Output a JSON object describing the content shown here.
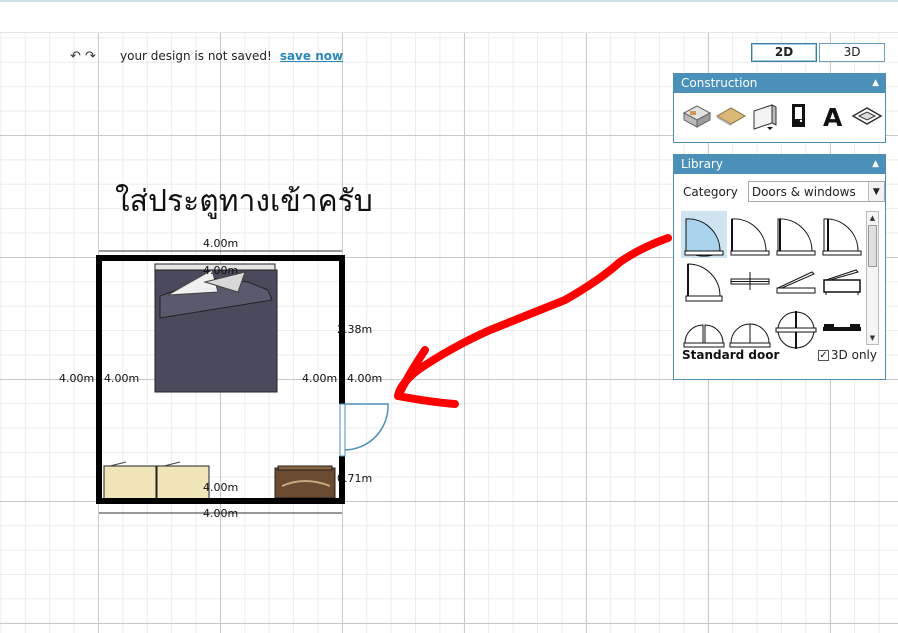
{
  "toolbar": {
    "undo_icon": "undo-icon",
    "redo_icon": "redo-icon",
    "status": "your design is not saved!",
    "save_label": "save now"
  },
  "view_toggle": {
    "mode_2d": "2D",
    "mode_3d": "3D",
    "active": "2D"
  },
  "construction": {
    "title": "Construction",
    "tools": [
      "create-room-icon",
      "floor-icon",
      "wall-icon",
      "door-icon",
      "text-icon",
      "surface-icon"
    ]
  },
  "library": {
    "title": "Library",
    "category_label": "Category",
    "category_value": "Doors & windows",
    "selected_item_name": "Standard door",
    "only_3d_label": "3D only",
    "only_3d_checked": true,
    "items": [
      "standard-door",
      "quarter-door",
      "double-quarter-door",
      "wide-door",
      "door-side",
      "sliding-window",
      "skewed-window",
      "box-window",
      "double-door",
      "double-door-small",
      "round-double-door",
      "bar-window"
    ]
  },
  "annotation": {
    "text": "ใส่ประตูทางเข้าครับ",
    "arrow_color": "#ff0000"
  },
  "floorplan": {
    "dims": {
      "top_outer": "4.00m",
      "top_inner": "4.00m",
      "left_outer": "4.00m",
      "left_inner": "4.00m",
      "right_inner": "4.00m",
      "right_outer": "4.00m",
      "right_top_segment": "2.38m",
      "bottom_inner": "4.00m",
      "bottom_outer": "4.00m",
      "door_gap": "0.71m"
    },
    "furniture": [
      "bed",
      "cabinet-left",
      "cabinet-right",
      "dresser"
    ]
  },
  "colors": {
    "accent": "#4a90b8",
    "link": "#2a88b8",
    "wall": "#000000",
    "bed": "#4a4a5c",
    "cabinet": "#efe5b8",
    "dresser": "#6b4a32",
    "door": "#4a90b8"
  }
}
